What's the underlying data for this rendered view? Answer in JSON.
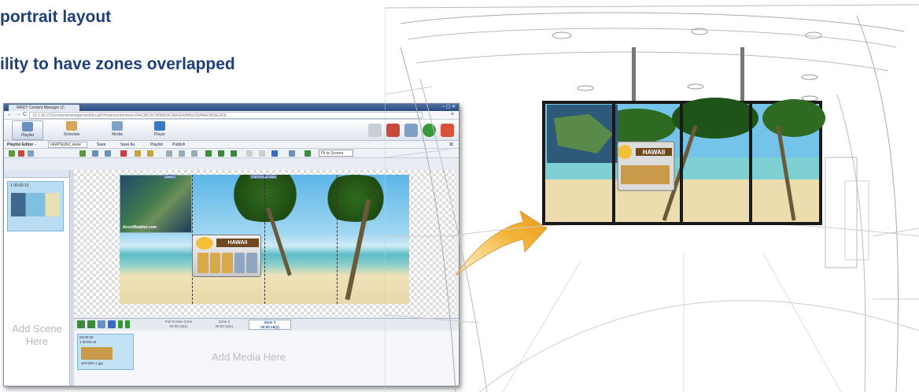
{
  "headings": {
    "line1": "portrait layout",
    "line2": "ility to have zones overlapped"
  },
  "colors": {
    "heading": "#1f3f7a",
    "accent_arrow": "#f4b73c",
    "frame": "#1a1a1a"
  },
  "app": {
    "tab_title": "WADT Content Manager (C",
    "url": "10.1.90.222/contentmanager/web/local/#/main/contents/a=JFACMCKCWMNOFDEKEWMNLOSPAEDHDEDDE",
    "nav": {
      "items": [
        {
          "label": "Playlist",
          "icon": "playlist-icon"
        },
        {
          "label": "Schedule",
          "icon": "schedule-icon"
        },
        {
          "label": "Media",
          "icon": "media-icon"
        },
        {
          "label": "Player",
          "icon": "player-icon"
        }
      ]
    },
    "editor": {
      "label": "Playlist Editor -",
      "name_value": "newPlaylist_www",
      "save": "Save",
      "save_as": "Save As",
      "playlist": "Playlist",
      "publish": "Publish",
      "fit": "Fit to Screen"
    },
    "scene": {
      "header": "1  00:00:15",
      "add_scene": "Add Scene Here"
    },
    "stage": {
      "map_brand": "AccuWeather.com",
      "weather_title": "HAWAII",
      "zone_tag_1": "Zone 2",
      "zone_tag_2": "Full Screen Zone"
    },
    "zone_tabs": [
      {
        "name": "Full Screen Zone",
        "time": "00:00:15(1)"
      },
      {
        "name": "Zone 2",
        "time": "00:00:15(1)"
      },
      {
        "name": "Zone 3",
        "time": "00:00:15(1)"
      }
    ],
    "media": {
      "time": "00:00:00",
      "sub": "1  00:00:15",
      "file": "WTHER-1.jpg",
      "add_media": "Add Media Here"
    }
  },
  "illustration": {
    "weather_title": "HAWAII"
  }
}
